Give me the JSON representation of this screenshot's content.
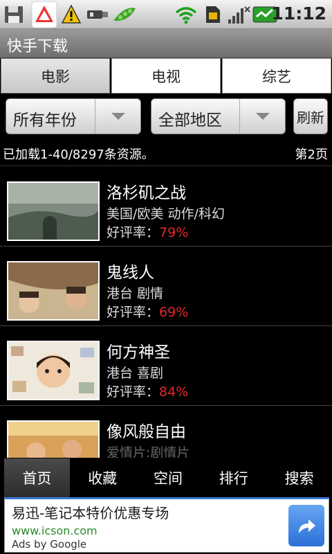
{
  "statusbar": {
    "time": "11:12",
    "icons": [
      "save-icon",
      "warning-triangle-icon",
      "warning-icon",
      "usb-icon",
      "pea-pod-icon",
      "wifi-icon",
      "sim-icon",
      "no-signal-icon",
      "battery-icon"
    ]
  },
  "titlebar": {
    "title": "快手下载"
  },
  "tabs": [
    {
      "label": "电影",
      "active": true
    },
    {
      "label": "电视",
      "active": false
    },
    {
      "label": "综艺",
      "active": false
    }
  ],
  "filters": {
    "year": "所有年份",
    "region": "全部地区",
    "refresh": "刷新"
  },
  "info": {
    "count_text": "已加载1-40/8297条资源。",
    "page_text": "第2页"
  },
  "items": [
    {
      "title": "洛杉矶之战",
      "meta": "美国/欧美  动作/科幻",
      "rating_label": "好评率：",
      "rating": "79%"
    },
    {
      "title": "鬼线人",
      "meta": "港台  剧情",
      "rating_label": "好评率：",
      "rating": "69%"
    },
    {
      "title": "何方神圣",
      "meta": "港台  喜剧",
      "rating_label": "好评率：",
      "rating": "84%"
    },
    {
      "title": "像风般自由",
      "meta": "爱情片:剧情片",
      "rating_label": "",
      "rating": ""
    }
  ],
  "bottomnav": [
    {
      "label": "首页",
      "active": true
    },
    {
      "label": "收藏",
      "active": false
    },
    {
      "label": "空间",
      "active": false
    },
    {
      "label": "排行",
      "active": false
    },
    {
      "label": "搜索",
      "active": false
    }
  ],
  "ad": {
    "headline": "易迅-笔记本特价优惠专场",
    "url": "www.icson.com",
    "byline": "Ads by Google"
  },
  "colors": {
    "rating": "#e8262b",
    "ad_url": "#2b8a2b",
    "ad_button": "#2c6fd6"
  }
}
